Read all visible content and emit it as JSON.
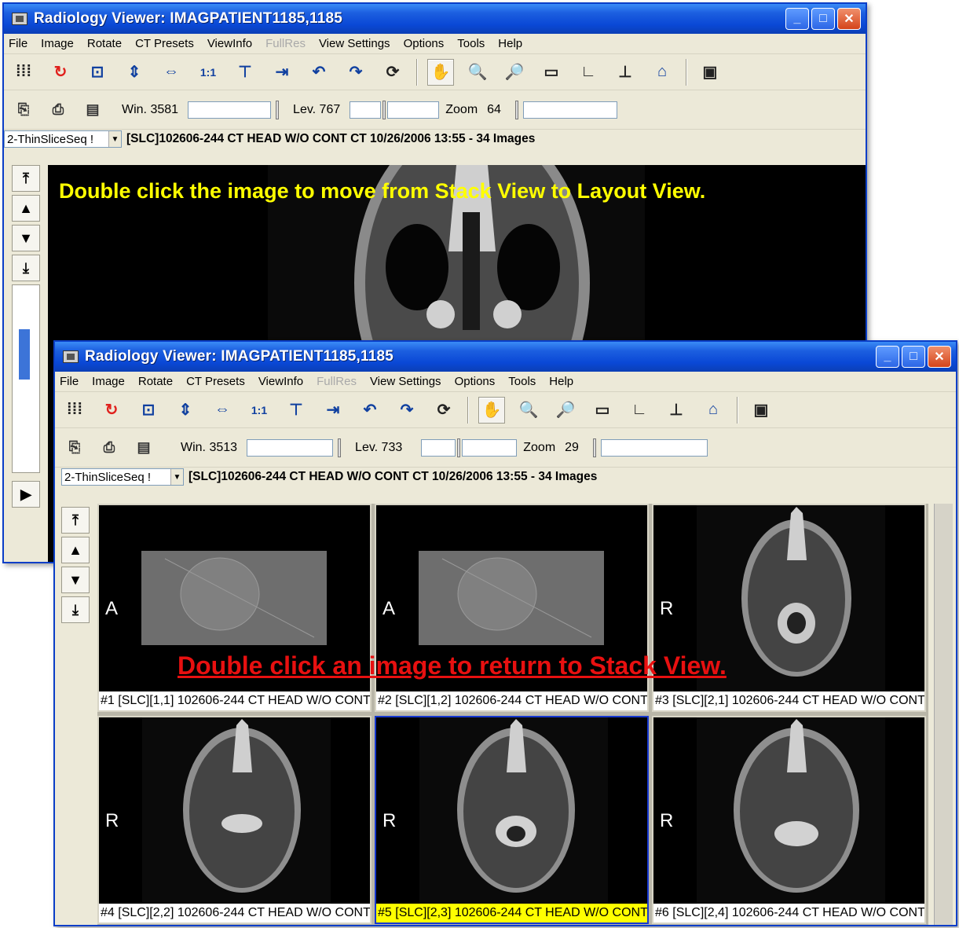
{
  "back": {
    "title": "Radiology Viewer: IMAGPATIENT1185,1185",
    "menu": [
      "File",
      "Image",
      "Rotate",
      "CT Presets",
      "ViewInfo",
      "FullRes",
      "View Settings",
      "Options",
      "Tools",
      "Help"
    ],
    "win_label": "Win. 3581",
    "lev_label": "Lev. 767",
    "zoom_label": "Zoom",
    "zoom_value": "64",
    "series": "2-ThinSliceSeq !",
    "info": "[SLC]102606-244  CT HEAD W/O CONT CT 10/26/2006 13:55  - 34  Images",
    "instruction": "Double click the image to move from Stack View to Layout View."
  },
  "front": {
    "title": "Radiology Viewer: IMAGPATIENT1185,1185",
    "menu": [
      "File",
      "Image",
      "Rotate",
      "CT Presets",
      "ViewInfo",
      "FullRes",
      "View Settings",
      "Options",
      "Tools",
      "Help"
    ],
    "win_label": "Win. 3513",
    "lev_label": "Lev. 733",
    "zoom_label": "Zoom",
    "zoom_value": "29",
    "series": "2-ThinSliceSeq !",
    "info": "[SLC]102606-244  CT HEAD W/O CONT CT 10/26/2006 13:55  - 34  Images",
    "instruction": "Double click an image to return to Stack View.",
    "cells": [
      {
        "orient": "A",
        "caption": "#1 [SLC][1,1] 102606-244  CT HEAD W/O CONT"
      },
      {
        "orient": "A",
        "caption": "#2 [SLC][1,2] 102606-244  CT HEAD W/O CONT"
      },
      {
        "orient": "R",
        "caption": "#3 [SLC][2,1] 102606-244  CT HEAD W/O CONT"
      },
      {
        "orient": "R",
        "caption": "#4 [SLC][2,2] 102606-244  CT HEAD W/O CONT"
      },
      {
        "orient": "R",
        "caption": "#5 [SLC][2,3] 102606-244  CT HEAD W/O CONT"
      },
      {
        "orient": "R",
        "caption": "#6 [SLC][2,4] 102606-244  CT HEAD W/O CONT"
      }
    ]
  },
  "colors": {
    "titlebar": "#0a48d6",
    "instruction_yellow": "#ffff00",
    "instruction_red": "#e81010",
    "selected_caption": "#ffff00",
    "selected_border": "#1638d0"
  },
  "icons": [
    "grid-layout-icon",
    "refresh-icon",
    "fit-icon",
    "flip-vertical-icon",
    "flip-horizontal-icon",
    "one-to-one-icon",
    "top-align-icon",
    "fit-width-icon",
    "rotate-left-icon",
    "rotate-right-icon",
    "reset-rotation-icon",
    "hand-pan-icon",
    "magnify-icon",
    "zoom-icon",
    "measure-icon",
    "angle-icon",
    "cobb-angle-icon",
    "roi-icon",
    "window-icon"
  ]
}
